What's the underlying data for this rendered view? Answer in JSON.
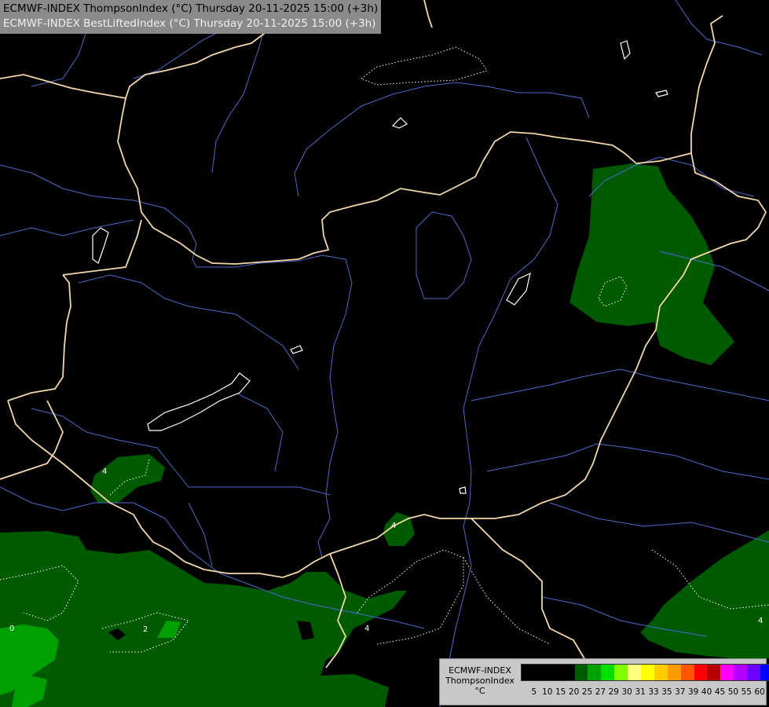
{
  "header": {
    "line1": "ECMWF-INDEX ThompsonIndex (°C) Thursday 20-11-2025 15:00 (+3h)",
    "line2": "ECMWF-INDEX BestLiftedIndex (°C) Thursday 20-11-2025 15:00 (+3h)"
  },
  "legend": {
    "line1": "ECMWF-INDEX",
    "line2": "ThompsonIndex",
    "line3": "°C",
    "ticks": [
      "5",
      "10",
      "15",
      "20",
      "25",
      "27",
      "29",
      "30",
      "31",
      "33",
      "35",
      "37",
      "39",
      "40",
      "45",
      "50",
      "55",
      "60"
    ],
    "colors": [
      "#000000",
      "#000000",
      "#000000",
      "#000000",
      "#005a00",
      "#00a000",
      "#00e000",
      "#80ff00",
      "#ffff80",
      "#ffff00",
      "#ffcc00",
      "#ff9900",
      "#ff5500",
      "#ff0000",
      "#b40000",
      "#ff00ff",
      "#b400ff",
      "#6a00ff",
      "#0000ff"
    ]
  },
  "contour_labels": [
    "4",
    "4",
    "2",
    "4",
    "4",
    "0"
  ],
  "colors": {
    "background": "#000000",
    "border": "#f5d7a8",
    "river": "#4a6ad0",
    "band_dark_green": "#005a00",
    "band_green": "#00a000",
    "lake": "#ffffff"
  }
}
